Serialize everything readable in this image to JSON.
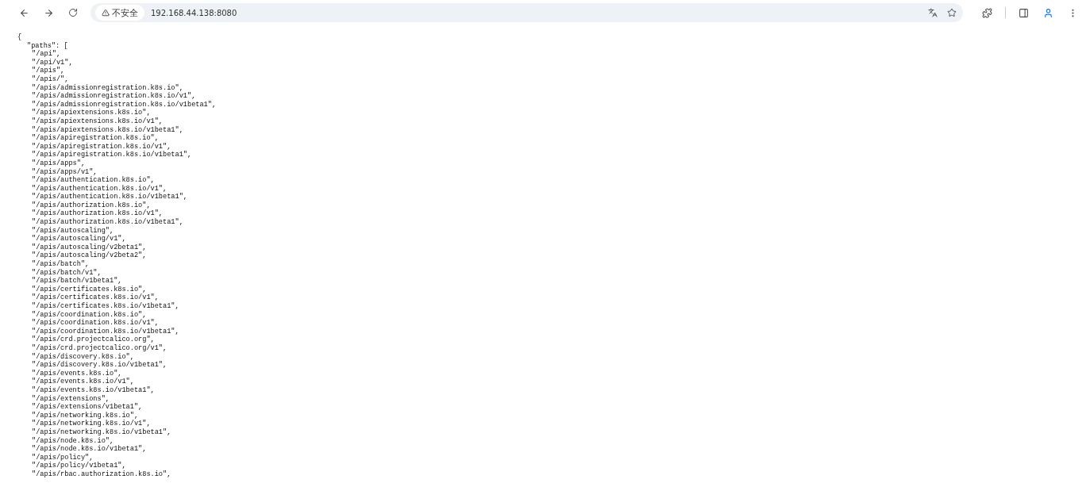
{
  "browser": {
    "security_label": "不安全",
    "url": "192.168.44.138:8080"
  },
  "document": {
    "opening": "{",
    "key_line": "\"paths\": [",
    "paths": [
      "\"/api\",",
      "\"/api/v1\",",
      "\"/apis\",",
      "\"/apis/\",",
      "\"/apis/admissionregistration.k8s.io\",",
      "\"/apis/admissionregistration.k8s.io/v1\",",
      "\"/apis/admissionregistration.k8s.io/v1beta1\",",
      "\"/apis/apiextensions.k8s.io\",",
      "\"/apis/apiextensions.k8s.io/v1\",",
      "\"/apis/apiextensions.k8s.io/v1beta1\",",
      "\"/apis/apiregistration.k8s.io\",",
      "\"/apis/apiregistration.k8s.io/v1\",",
      "\"/apis/apiregistration.k8s.io/v1beta1\",",
      "\"/apis/apps\",",
      "\"/apis/apps/v1\",",
      "\"/apis/authentication.k8s.io\",",
      "\"/apis/authentication.k8s.io/v1\",",
      "\"/apis/authentication.k8s.io/v1beta1\",",
      "\"/apis/authorization.k8s.io\",",
      "\"/apis/authorization.k8s.io/v1\",",
      "\"/apis/authorization.k8s.io/v1beta1\",",
      "\"/apis/autoscaling\",",
      "\"/apis/autoscaling/v1\",",
      "\"/apis/autoscaling/v2beta1\",",
      "\"/apis/autoscaling/v2beta2\",",
      "\"/apis/batch\",",
      "\"/apis/batch/v1\",",
      "\"/apis/batch/v1beta1\",",
      "\"/apis/certificates.k8s.io\",",
      "\"/apis/certificates.k8s.io/v1\",",
      "\"/apis/certificates.k8s.io/v1beta1\",",
      "\"/apis/coordination.k8s.io\",",
      "\"/apis/coordination.k8s.io/v1\",",
      "\"/apis/coordination.k8s.io/v1beta1\",",
      "\"/apis/crd.projectcalico.org\",",
      "\"/apis/crd.projectcalico.org/v1\",",
      "\"/apis/discovery.k8s.io\",",
      "\"/apis/discovery.k8s.io/v1beta1\",",
      "\"/apis/events.k8s.io\",",
      "\"/apis/events.k8s.io/v1\",",
      "\"/apis/events.k8s.io/v1beta1\",",
      "\"/apis/extensions\",",
      "\"/apis/extensions/v1beta1\",",
      "\"/apis/networking.k8s.io\",",
      "\"/apis/networking.k8s.io/v1\",",
      "\"/apis/networking.k8s.io/v1beta1\",",
      "\"/apis/node.k8s.io\",",
      "\"/apis/node.k8s.io/v1beta1\",",
      "\"/apis/policy\",",
      "\"/apis/policy/v1beta1\",",
      "\"/apis/rbac.authorization.k8s.io\","
    ]
  }
}
